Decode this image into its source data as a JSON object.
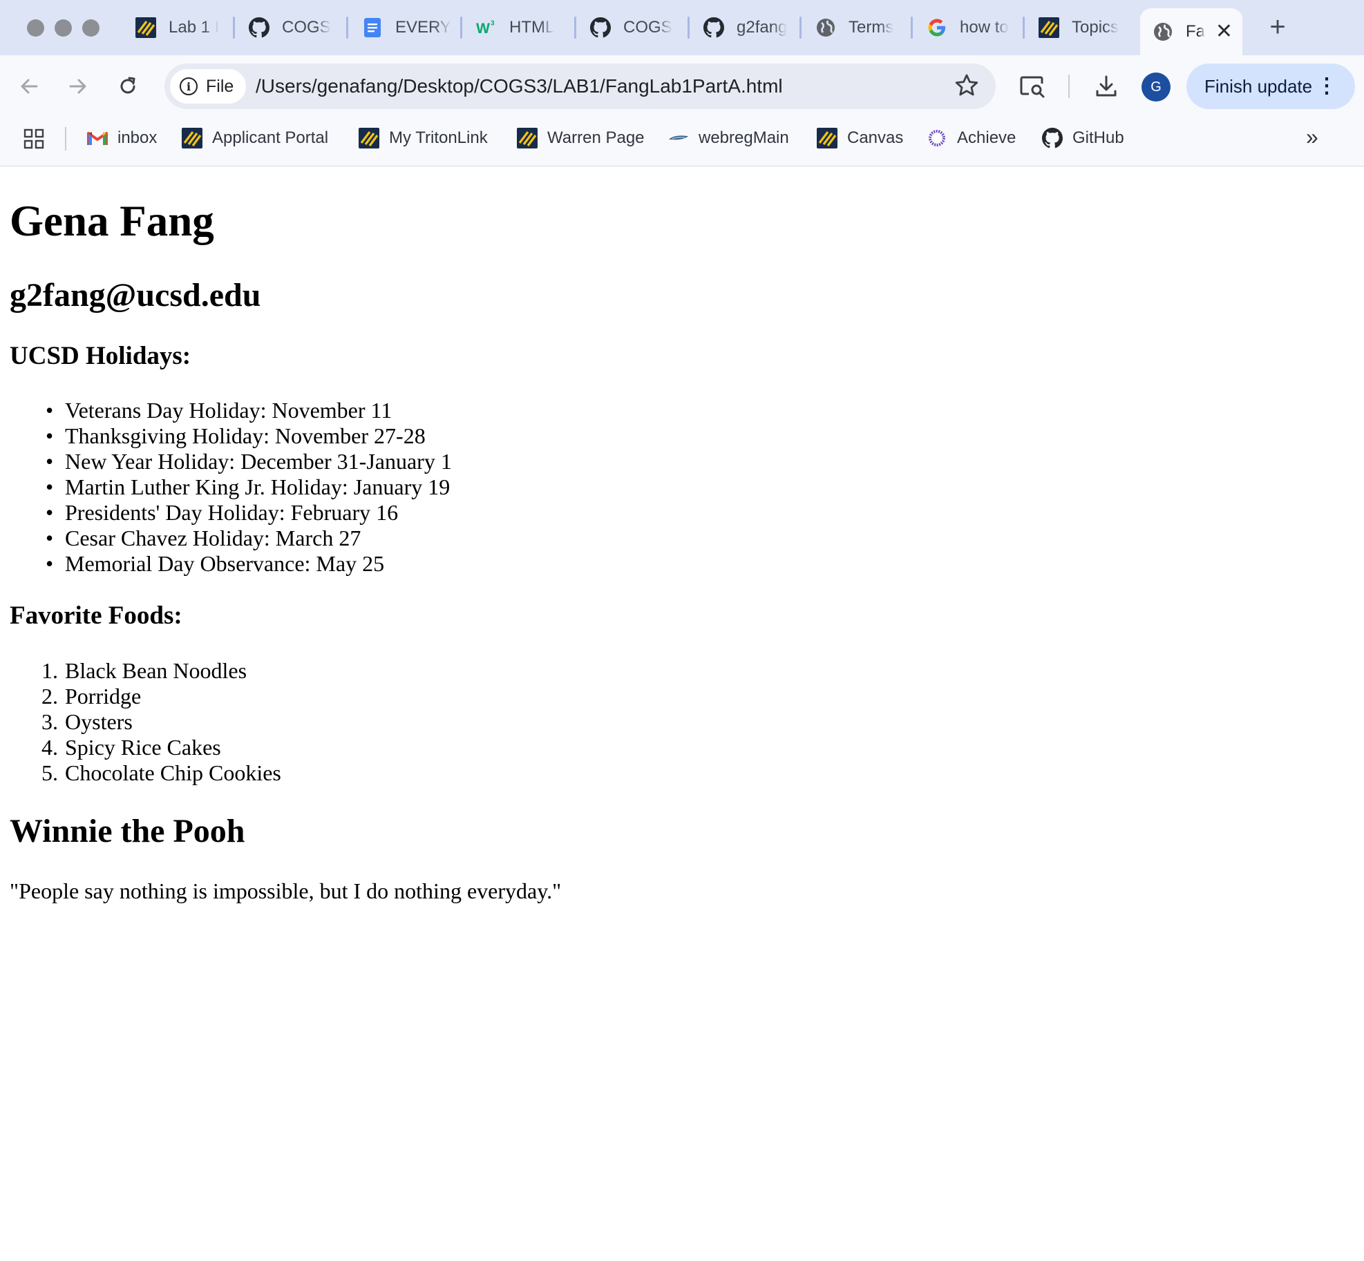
{
  "browser": {
    "tabs": [
      {
        "title": "Lab 1 I",
        "icon": "ucsd-icon"
      },
      {
        "title": "COGS",
        "icon": "github-icon"
      },
      {
        "title": "EVERY",
        "icon": "google-docs-icon"
      },
      {
        "title": "HTML",
        "icon": "w3schools-icon"
      },
      {
        "title": "COGS",
        "icon": "github-icon"
      },
      {
        "title": "g2fang",
        "icon": "github-icon"
      },
      {
        "title": "Terms",
        "icon": "globe-icon"
      },
      {
        "title": "how to",
        "icon": "google-icon"
      },
      {
        "title": "Topics",
        "icon": "ucsd-icon"
      },
      {
        "title": "Fa",
        "icon": "globe-icon",
        "active": true
      }
    ],
    "new_tab_label": "+",
    "address": {
      "scheme_chip": "File",
      "url": "/Users/genafang/Desktop/COGS3/LAB1/FangLab1PartA.html"
    },
    "profile_initial": "G",
    "finish_update_label": "Finish update",
    "bookmarks": [
      {
        "label": "inbox",
        "icon": "gmail-icon"
      },
      {
        "label": "Applicant Portal",
        "icon": "ucsd-icon"
      },
      {
        "label": "My TritonLink",
        "icon": "ucsd-icon"
      },
      {
        "label": "Warren Page",
        "icon": "ucsd-icon"
      },
      {
        "label": "webregMain",
        "icon": "webreg-icon"
      },
      {
        "label": "Canvas",
        "icon": "ucsd-icon"
      },
      {
        "label": "Achieve",
        "icon": "achieve-icon"
      },
      {
        "label": "GitHub",
        "icon": "github-icon"
      }
    ],
    "colors": {
      "tabstrip": "#dde4f5",
      "toolbar": "#f8f9fc",
      "finish_update_bg": "#d3e3fd",
      "avatar": "#1d4fa0"
    }
  },
  "page": {
    "name": "Gena Fang",
    "email": "g2fang@ucsd.edu",
    "holidays_heading": "UCSD Holidays:",
    "holidays": [
      "Veterans Day Holiday: November 11",
      "Thanksgiving Holiday: November 27-28",
      "New Year Holiday: December 31-January 1",
      "Martin Luther King Jr. Holiday: January 19",
      "Presidents' Day Holiday: February 16",
      "Cesar Chavez Holiday: March 27",
      "Memorial Day Observance: May 25"
    ],
    "foods_heading": "Favorite Foods:",
    "foods": [
      "Black Bean Noodles",
      "Porridge",
      "Oysters",
      "Spicy Rice Cakes",
      "Chocolate Chip Cookies"
    ],
    "quote_heading": "Winnie the Pooh",
    "quote": "\"People say nothing is impossible, but I do nothing everyday.\""
  }
}
